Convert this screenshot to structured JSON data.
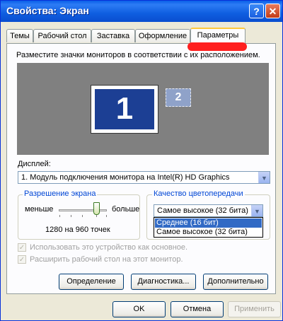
{
  "window": {
    "title": "Свойства: Экран",
    "help_button": "?",
    "close_button": "✕"
  },
  "tabs": [
    {
      "label": "Темы"
    },
    {
      "label": "Рабочий стол"
    },
    {
      "label": "Заставка"
    },
    {
      "label": "Оформление"
    },
    {
      "label": "Параметры"
    }
  ],
  "instruction": "Разместите значки мониторов в соответствии с их расположением.",
  "monitors": {
    "primary_label": "1",
    "secondary_label": "2"
  },
  "display": {
    "label": "Дисплей:",
    "value": "1. Модуль подключения монитора на Intel(R) HD Graphics"
  },
  "resolution": {
    "group_label": "Разрешение экрана",
    "less_label": "меньше",
    "more_label": "больше",
    "value_text": "1280 на 960 точек"
  },
  "color_quality": {
    "group_label": "Качество цветопередачи",
    "selected": "Самое высокое (32 бита)",
    "options": [
      {
        "label": "Среднее (16 бит)",
        "highlighted": true
      },
      {
        "label": "Самое высокое (32 бита)",
        "highlighted": false
      }
    ]
  },
  "checkboxes": [
    {
      "label": "Использовать это устройство как основное.",
      "checked": true
    },
    {
      "label": "Расширить рабочий стол на этот монитор.",
      "checked": true
    }
  ],
  "buttons": {
    "identify": "Определение",
    "troubleshoot": "Диагностика...",
    "advanced": "Дополнительно",
    "ok": "OK",
    "cancel": "Отмена",
    "apply": "Применить"
  },
  "colors": {
    "title_bar": "#0a5fe8",
    "highlight": "#316ac5",
    "annotation_mark": "#ff1f1f"
  }
}
